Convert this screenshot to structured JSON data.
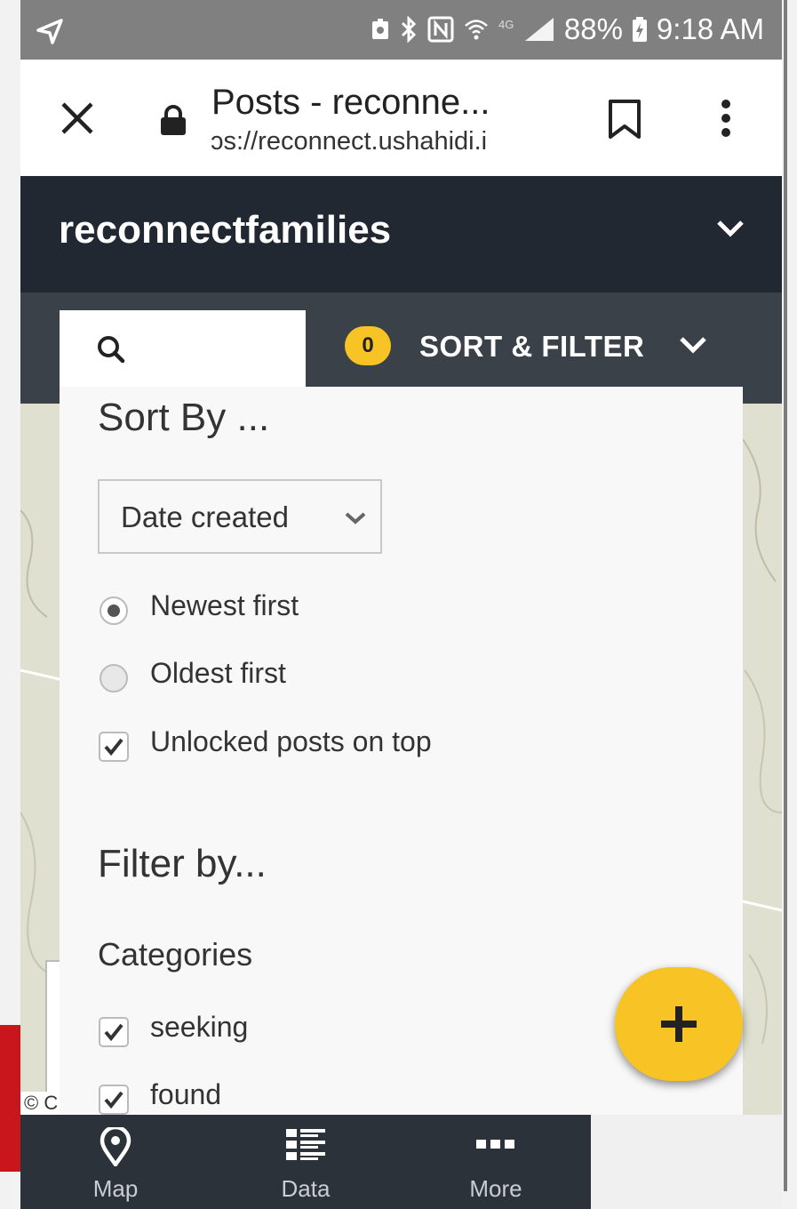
{
  "status_bar": {
    "battery": "88%",
    "time": "9:18 AM"
  },
  "browser": {
    "page_title": "Posts - reconne...",
    "url": "ɔs://reconnect.ushahidi.i"
  },
  "header": {
    "deployment_name": "reconnectfamilies"
  },
  "toolbar": {
    "filter_count": "0",
    "sort_filter_label": "SORT & FILTER"
  },
  "sort": {
    "heading": "Sort By ...",
    "select_value": "Date created",
    "options": [
      {
        "label": "Newest first",
        "selected": true
      },
      {
        "label": "Oldest first",
        "selected": false
      }
    ],
    "unlocked_on_top": {
      "label": "Unlocked posts on top",
      "checked": true
    }
  },
  "filter": {
    "heading": "Filter by...",
    "categories_heading": "Categories",
    "categories": [
      {
        "label": "seeking",
        "checked": true
      },
      {
        "label": "found",
        "checked": true
      }
    ]
  },
  "map": {
    "attribution": "© C"
  },
  "nav": [
    {
      "label": "Map",
      "icon": "map-pin-icon"
    },
    {
      "label": "Data",
      "icon": "list-icon"
    },
    {
      "label": "More",
      "icon": "more-dots-icon"
    }
  ],
  "colors": {
    "accent": "#f7c325",
    "header_bg": "#222831",
    "subbar_bg": "#3b4149",
    "status_bar": "#808080"
  }
}
